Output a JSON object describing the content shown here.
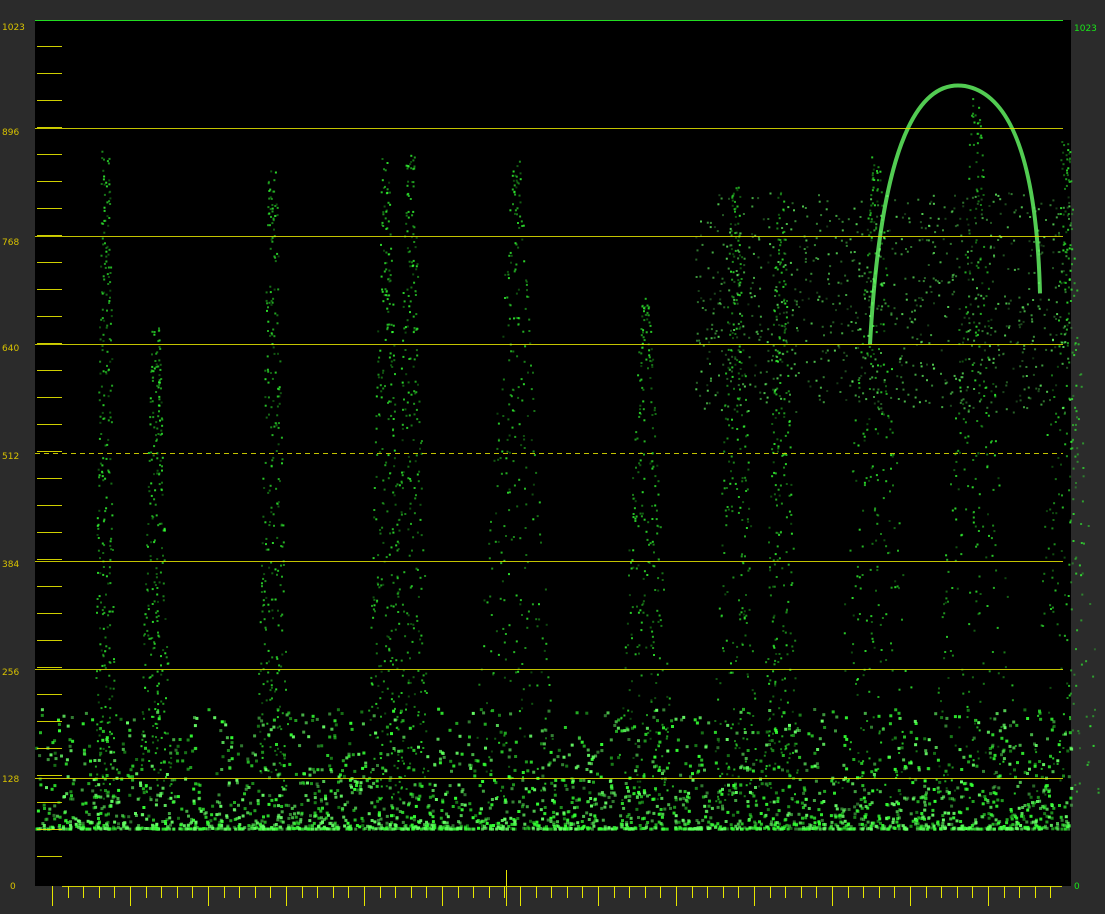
{
  "scope": {
    "type": "waveform",
    "scale_left": [
      "1023",
      "896",
      "768",
      "640",
      "512",
      "384",
      "256",
      "128",
      "0"
    ],
    "scale_right_top": "1023",
    "scale_right_bottom": "0",
    "graticule_levels": [
      896,
      768,
      640,
      512,
      384,
      256,
      128
    ],
    "dashed_level": 512,
    "range": [
      0,
      1023
    ],
    "colors": {
      "background": "#2b2b2b",
      "scope_bg": "#000000",
      "graticule": "#e6e600",
      "left_labels": "#d8c200",
      "right_labels": "#19e619",
      "trace": "#33ff33",
      "trace_bright": "#66ff66",
      "top_border": "#22dd22"
    }
  }
}
